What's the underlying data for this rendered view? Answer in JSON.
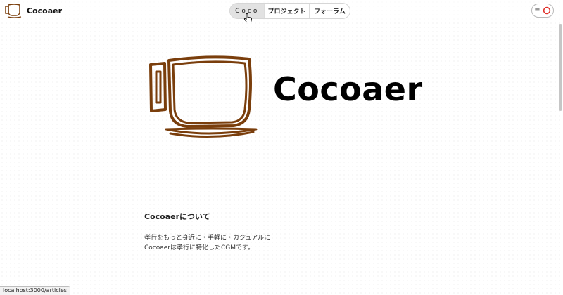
{
  "header": {
    "brand_name": "Cocoaer",
    "nav": [
      {
        "label": "Coco",
        "active": true
      },
      {
        "label": "プロジェクト",
        "active": false
      },
      {
        "label": "フォーラム",
        "active": false
      }
    ],
    "menu_icon": "≡"
  },
  "hero": {
    "title": "Cocoaer",
    "logo_icon": "coffee-cup-icon",
    "logo_color": "#7a3e0c"
  },
  "about": {
    "title": "Cocoaerについて",
    "line1": "孝行をもっと身近に・手軽に・カジュアルに",
    "line2": "Cocoaerは孝行に特化したCGMです。"
  },
  "status_bar": {
    "url": "localhost:3000/articles"
  },
  "colors": {
    "accent_red": "#e0302a",
    "cup_brown": "#7a3e0c"
  }
}
